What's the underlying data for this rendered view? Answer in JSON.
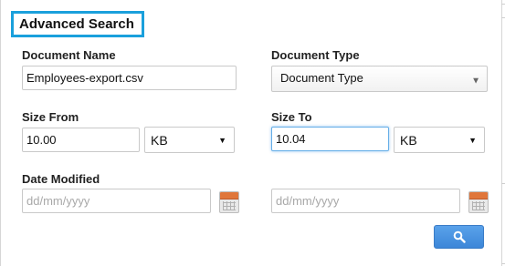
{
  "panel": {
    "title": "Advanced Search"
  },
  "fields": {
    "document_name": {
      "label": "Document Name",
      "value": "Employees-export.csv"
    },
    "document_type": {
      "label": "Document Type",
      "selected": "Document Type"
    },
    "size_from": {
      "label": "Size From",
      "value": "10.00",
      "unit": "KB"
    },
    "size_to": {
      "label": "Size To",
      "value": "10.04",
      "unit": "KB"
    },
    "date_modified": {
      "label": "Date Modified",
      "from_placeholder": "dd/mm/yyyy",
      "to_placeholder": "dd/mm/yyyy"
    }
  },
  "icons": {
    "dropdown": "triangle-down-icon",
    "calendar": "calendar-icon",
    "search": "magnifier-icon"
  },
  "colors": {
    "accent": "#1aa0dc",
    "button": "#4a94e0",
    "calendar": "#e0763a"
  }
}
